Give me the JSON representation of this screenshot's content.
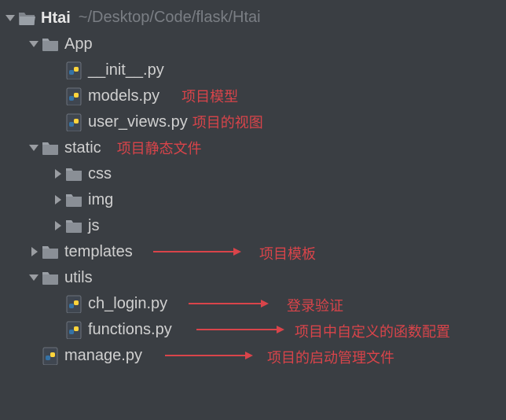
{
  "root": {
    "name": "Htai",
    "path": "~/Desktop/Code/flask/Htai"
  },
  "nodes": {
    "app": "App",
    "app_init": "__init__.py",
    "app_models": "models.py",
    "app_user_views": "user_views.py",
    "static": "static",
    "static_css": "css",
    "static_img": "img",
    "static_js": "js",
    "templates": "templates",
    "utils": "utils",
    "utils_ch_login": "ch_login.py",
    "utils_functions": "functions.py",
    "manage": "manage.py"
  },
  "annotations": {
    "models": "项目模型",
    "user_views": "项目的视图",
    "static": "项目静态文件",
    "templates": "项目模板",
    "ch_login": "登录验证",
    "functions": "项目中自定义的函数配置",
    "manage": "项目的启动管理文件"
  }
}
